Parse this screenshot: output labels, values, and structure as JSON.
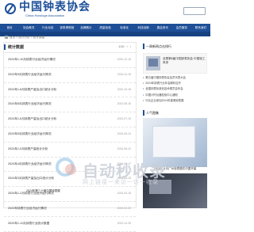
{
  "header": {
    "logo_cn": "中国钟表协会",
    "logo_en": "China Horologe Association"
  },
  "nav": {
    "items": [
      "首页",
      "协会概况",
      "行业动态",
      "钟表博物馆",
      "品牌展示",
      "质量检验",
      "标准化",
      "科技创新",
      "展会资讯",
      "会员服务",
      "联系我们"
    ]
  },
  "breadcrumb": "首页 > 统计分析 > 统计数据",
  "left_panel": {
    "title": "统计数据",
    "pager_current": "1/10",
    "pager_prev": "‹",
    "pager_next": "›",
    "items": [
      {
        "title": "2024年1-10月钟表行业经济运行情况",
        "date": "2024-12-16"
      },
      {
        "title": "2024年9月钟表行业经济运行简况",
        "date": "2024-11-15"
      },
      {
        "title": "2024年1-8月钟表产量及出口统计分析",
        "date": "2024-10-18"
      },
      {
        "title": "2024年6月钟表行业经济运行简况",
        "date": "2024-08-16"
      },
      {
        "title": "2024年1-6月钟表产量及出口统计分析",
        "date": "2024-07-19"
      },
      {
        "title": "2024年5月钟表行业经济运行简况",
        "date": "2024-06-14"
      },
      {
        "title": "2024年1-5月钟表产量统计分析",
        "date": "2024-06-12"
      },
      {
        "title": "2024年4月钟表行业经济运行简况",
        "date": "2024-05-17"
      },
      {
        "title": "2024年3月钟表产量及出口统计分析",
        "date": "2024-04-19"
      },
      {
        "title": "2024年1-2月钟表行业经济运行简况",
        "date": "2024-03-15"
      },
      {
        "title": "2023年钟表行业经济运行情况",
        "date": "2024-02-20"
      },
      {
        "title": "2023年1-11月钟表行业统计数据",
        "date": "2023-12-29"
      }
    ]
  },
  "right_panel": {
    "news_title": "一周新闻点击排行",
    "feature_caption": "这是第6届中国钟表协会·中国轻工风采",
    "news_items": [
      "第五届中国钟表协会会员代表大会",
      "2024年钟表行业年会顺利召开",
      "全国钟表标准化技术委员会年会",
      "中国计时仪器检验中心通知",
      "行业企业参加2024年香港钟表展"
    ],
    "hot_title": "人气图集",
    "photo1_caption": "2024年11月广州钟表展在中国开幕",
    "photo2_caption": "2024年第三十届中国钟表展"
  },
  "watermark": {
    "main": "自动秒收录",
    "sub": "网上链接一来访一访一收录"
  }
}
